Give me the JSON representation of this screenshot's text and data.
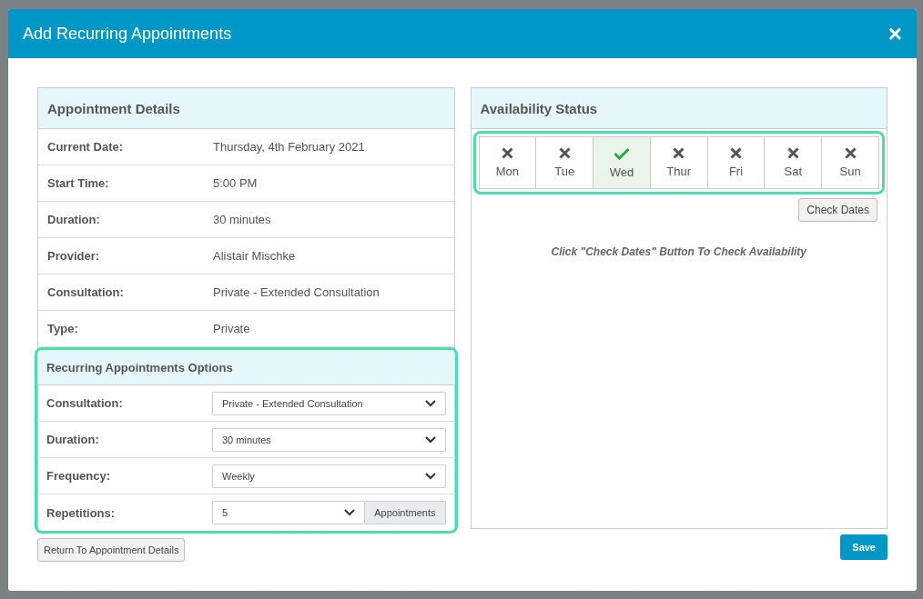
{
  "dialog": {
    "title": "Add Recurring Appointments",
    "close": "×"
  },
  "details": {
    "title": "Appointment Details",
    "rows": [
      {
        "label": "Current Date:",
        "value": "Thursday, 4th February 2021"
      },
      {
        "label": "Start Time:",
        "value": "5:00 PM"
      },
      {
        "label": "Duration:",
        "value": "30 minutes"
      },
      {
        "label": "Provider:",
        "value": "Alistair Mischke"
      },
      {
        "label": "Consultation:",
        "value": "Private - Extended Consultation"
      },
      {
        "label": "Type:",
        "value": "Private"
      }
    ]
  },
  "options": {
    "title": "Recurring Appointments Options",
    "rows": [
      {
        "label": "Consultation:",
        "value": "Private - Extended Consultation"
      },
      {
        "label": "Duration:",
        "value": "30 minutes"
      },
      {
        "label": "Frequency:",
        "value": "Weekly"
      },
      {
        "label": "Repetitions:",
        "value": "5",
        "addon": "Appointments"
      }
    ]
  },
  "return_button": "Return To Appointment Details",
  "availability": {
    "title": "Availability Status",
    "days": [
      {
        "label": "Mon",
        "selected": false
      },
      {
        "label": "Tue",
        "selected": false
      },
      {
        "label": "Wed",
        "selected": true
      },
      {
        "label": "Thur",
        "selected": false
      },
      {
        "label": "Fri",
        "selected": false
      },
      {
        "label": "Sat",
        "selected": false
      },
      {
        "label": "Sun",
        "selected": false
      }
    ],
    "check_button": "Check Dates",
    "hint": "Click \"Check Dates\" Button To Check Availability"
  },
  "save_button": "Save"
}
